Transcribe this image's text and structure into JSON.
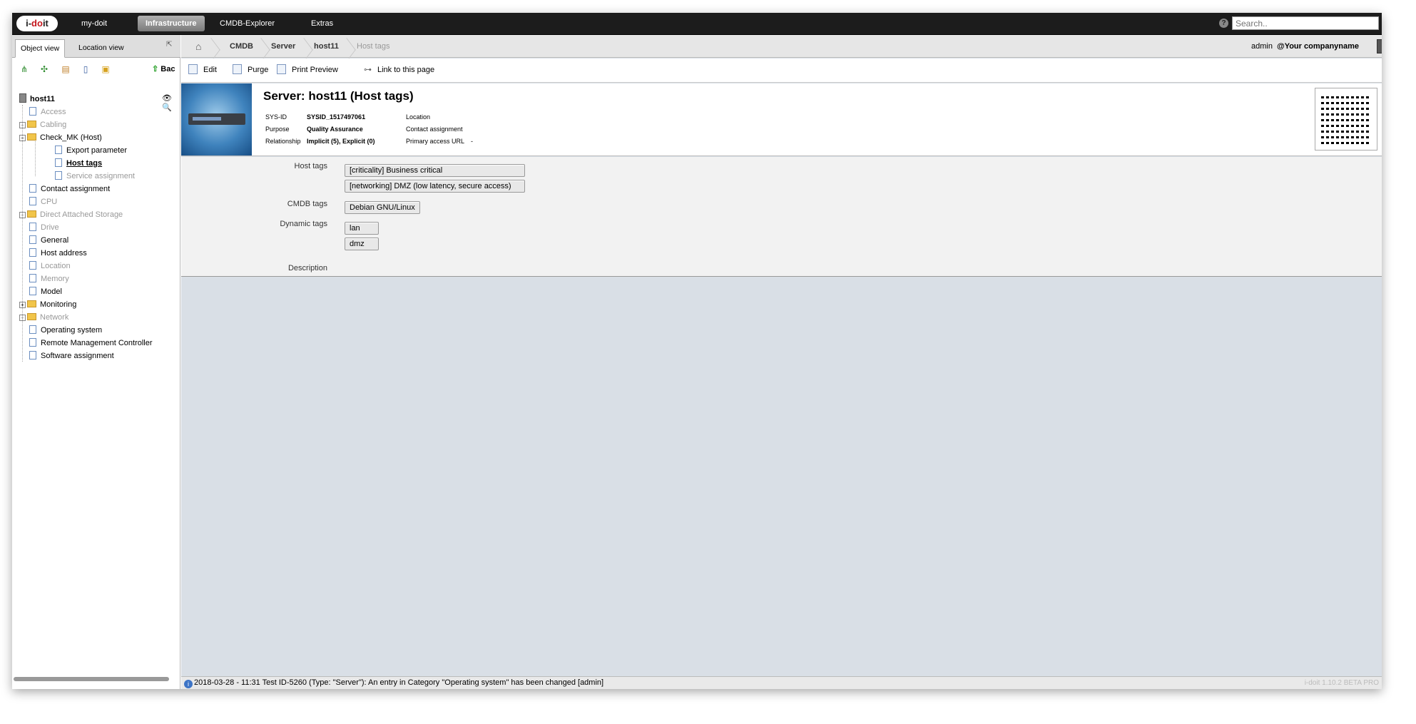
{
  "app": {
    "logo_text": "i-doit"
  },
  "topnav": {
    "items": [
      "my-doit",
      "Infrastructure",
      "CMDB-Explorer",
      "Extras"
    ],
    "active": "Infrastructure",
    "search_placeholder": "Search.."
  },
  "sidebar": {
    "tabs": [
      "Object view",
      "Location view"
    ],
    "back_label": "Bac",
    "object": "host11",
    "tree": [
      {
        "label": "Access",
        "state": "dim"
      },
      {
        "label": "Cabling",
        "state": "dim",
        "folder": true
      },
      {
        "label": "Check_MK (Host)",
        "state": "normal",
        "folder": true
      },
      {
        "label": "Export parameter",
        "state": "normal"
      },
      {
        "label": "Host tags",
        "state": "selected"
      },
      {
        "label": "Service assignment",
        "state": "dim"
      },
      {
        "label": "Contact assignment",
        "state": "normal"
      },
      {
        "label": "CPU",
        "state": "dim"
      },
      {
        "label": "Direct Attached Storage",
        "state": "dim",
        "folder": true
      },
      {
        "label": "Drive",
        "state": "dim"
      },
      {
        "label": "General",
        "state": "normal"
      },
      {
        "label": "Host address",
        "state": "normal"
      },
      {
        "label": "Location",
        "state": "dim"
      },
      {
        "label": "Memory",
        "state": "dim"
      },
      {
        "label": "Model",
        "state": "normal"
      },
      {
        "label": "Monitoring",
        "state": "normal",
        "folder": true
      },
      {
        "label": "Network",
        "state": "dim",
        "folder": true
      },
      {
        "label": "Operating system",
        "state": "normal"
      },
      {
        "label": "Remote Management Controller",
        "state": "normal"
      },
      {
        "label": "Software assignment",
        "state": "normal"
      }
    ]
  },
  "breadcrumb": [
    "CMDB",
    "Server",
    "host11",
    "Host tags"
  ],
  "user": {
    "name": "admin",
    "company": "@Your companyname"
  },
  "actions": [
    "Edit",
    "Purge",
    "Print Preview",
    "Link to this page"
  ],
  "header": {
    "title": "Server: host11 (Host tags)",
    "sysid_label": "SYS-ID",
    "sysid_value": "SYSID_1517497061",
    "purpose_label": "Purpose",
    "purpose_value": "Quality Assurance",
    "relationship_label": "Relationship",
    "relationship_value": "Implicit (5), Explicit (0)",
    "location_label": "Location",
    "contact_label": "Contact assignment",
    "url_label": "Primary access URL",
    "url_value": "-"
  },
  "form": {
    "host_tags_label": "Host tags",
    "host_tags": [
      "[criticality] Business critical",
      "[networking] DMZ (low latency, secure access)"
    ],
    "cmdb_tags_label": "CMDB tags",
    "cmdb_tags": [
      "Debian GNU/Linux"
    ],
    "dynamic_tags_label": "Dynamic tags",
    "dynamic_tags": [
      "lan",
      "dmz"
    ],
    "description_label": "Description"
  },
  "status": {
    "message": "2018-03-28 - 11:31 Test ID-5260 (Type: \"Server\"): An entry in Category \"Operating system\" has been changed [admin]",
    "version": "i-doit 1.10.2 BETA PRO"
  }
}
